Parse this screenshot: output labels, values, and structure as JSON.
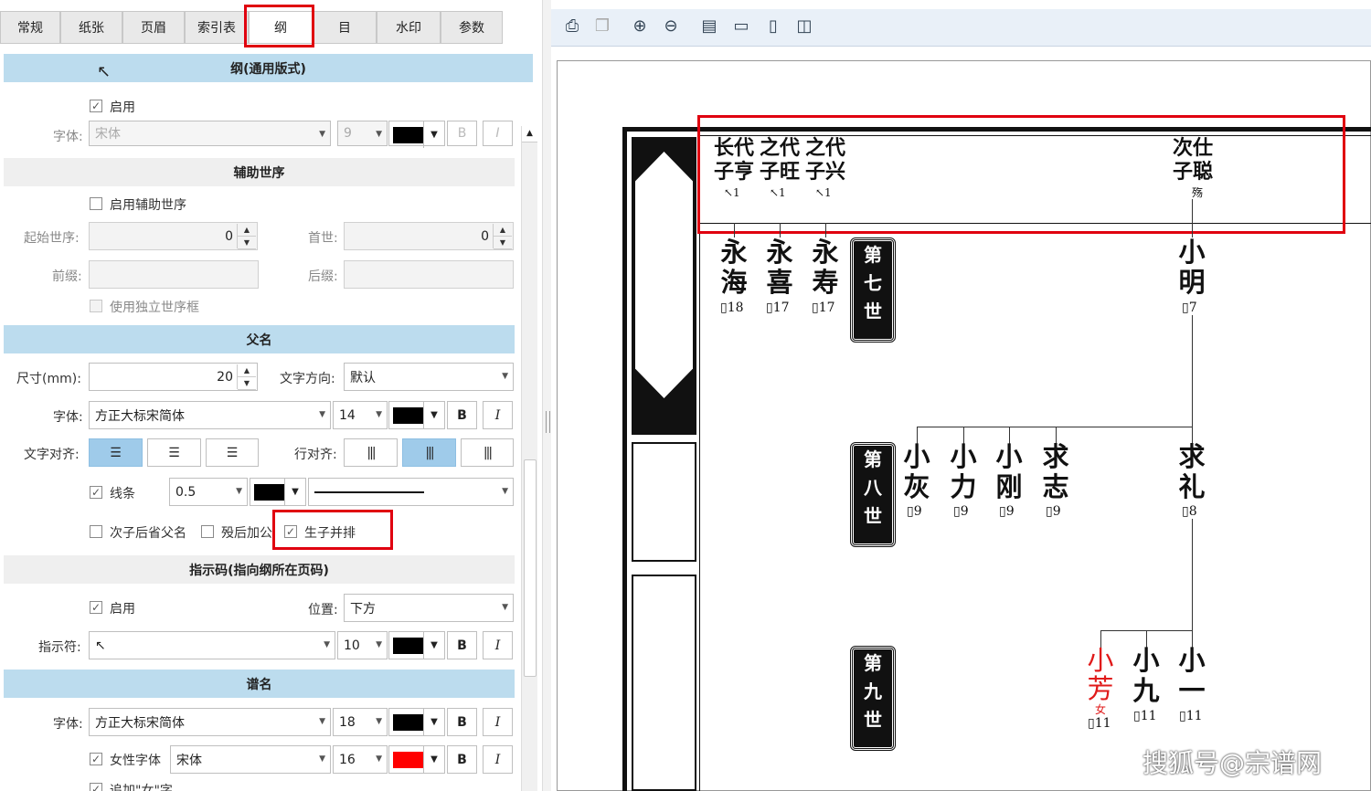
{
  "tabs": [
    "常规",
    "纸张",
    "页眉",
    "索引表",
    "纲",
    "目",
    "水印",
    "参数"
  ],
  "sections": {
    "gang_header": "纲(通用版式)",
    "aux_header": "辅助世序",
    "father_header": "父名",
    "index_header": "指示码(指向纲所在页码)",
    "pu_header": "谱名"
  },
  "gang": {
    "enable_label": "启用",
    "font_label": "字体:",
    "font_value": "宋体",
    "size_value": "9"
  },
  "aux": {
    "enable_label": "启用辅助世序",
    "start_label": "起始世序:",
    "start_value": "0",
    "first_label": "首世:",
    "first_value": "0",
    "prefix_label": "前缀:",
    "suffix_label": "后缀:",
    "independent_label": "使用独立世序框"
  },
  "father": {
    "size_label": "尺寸(mm):",
    "size_value": "20",
    "dir_label": "文字方向:",
    "dir_value": "默认",
    "font_label": "字体:",
    "font_value": "方正大标宋简体",
    "fontsize_value": "14",
    "align_label": "文字对齐:",
    "row_align_label": "行对齐:",
    "line_label": "线条",
    "line_value": "0.5",
    "opt1_label": "次子后省父名",
    "opt2_label": "殁后加公",
    "opt3_label": "生子并排",
    "bold": "B",
    "italic": "I"
  },
  "index": {
    "enable_label": "启用",
    "pos_label": "位置:",
    "pos_value": "下方",
    "char_label": "指示符:",
    "char_value": "↖",
    "size_value": "10"
  },
  "pu": {
    "font_label": "字体:",
    "font_value": "方正大标宋简体",
    "size_value": "18",
    "female_label": "女性字体",
    "female_font": "宋体",
    "female_size": "16",
    "extra_label": "追加\"女\"字"
  },
  "colors": {
    "accent": "#bcdcee",
    "highlight": "#e0000f",
    "female": "#ff0000"
  },
  "toolbar_icons": [
    "print-icon",
    "copy-icon",
    "zoom-in-icon",
    "zoom-out-icon",
    "page-view-icon",
    "page-width-icon",
    "single-page-icon",
    "two-page-icon"
  ],
  "tree": {
    "top_names": [
      {
        "l1": "长代",
        "l2": "子亨",
        "mk": "↖1"
      },
      {
        "l1": "之代",
        "l2": "子旺",
        "mk": "↖1"
      },
      {
        "l1": "之代",
        "l2": "子兴",
        "mk": "↖1"
      },
      {
        "l1": "次仕",
        "l2": "子聪",
        "mk": "殇"
      }
    ],
    "gen7": [
      "第",
      "七",
      "世"
    ],
    "gen8": [
      "第",
      "八",
      "世"
    ],
    "gen9": [
      "第",
      "九",
      "世"
    ],
    "g7": [
      {
        "a": "永",
        "b": "海",
        "p": "18"
      },
      {
        "a": "永",
        "b": "喜",
        "p": "17"
      },
      {
        "a": "永",
        "b": "寿",
        "p": "17"
      },
      {
        "a": "小",
        "b": "明",
        "p": "7"
      }
    ],
    "g8": [
      {
        "a": "小",
        "b": "灰",
        "p": "9"
      },
      {
        "a": "小",
        "b": "力",
        "p": "9"
      },
      {
        "a": "小",
        "b": "刚",
        "p": "9"
      },
      {
        "a": "求",
        "b": "志",
        "p": "9"
      },
      {
        "a": "求",
        "b": "礼",
        "p": "8"
      }
    ],
    "g9": [
      {
        "a": "小",
        "b": "芳",
        "p": "11",
        "f": "女"
      },
      {
        "a": "小",
        "b": "九",
        "p": "11"
      },
      {
        "a": "小",
        "b": "一",
        "p": "11"
      }
    ],
    "page_icon": "▯"
  },
  "watermark": "搜狐号@宗谱网"
}
